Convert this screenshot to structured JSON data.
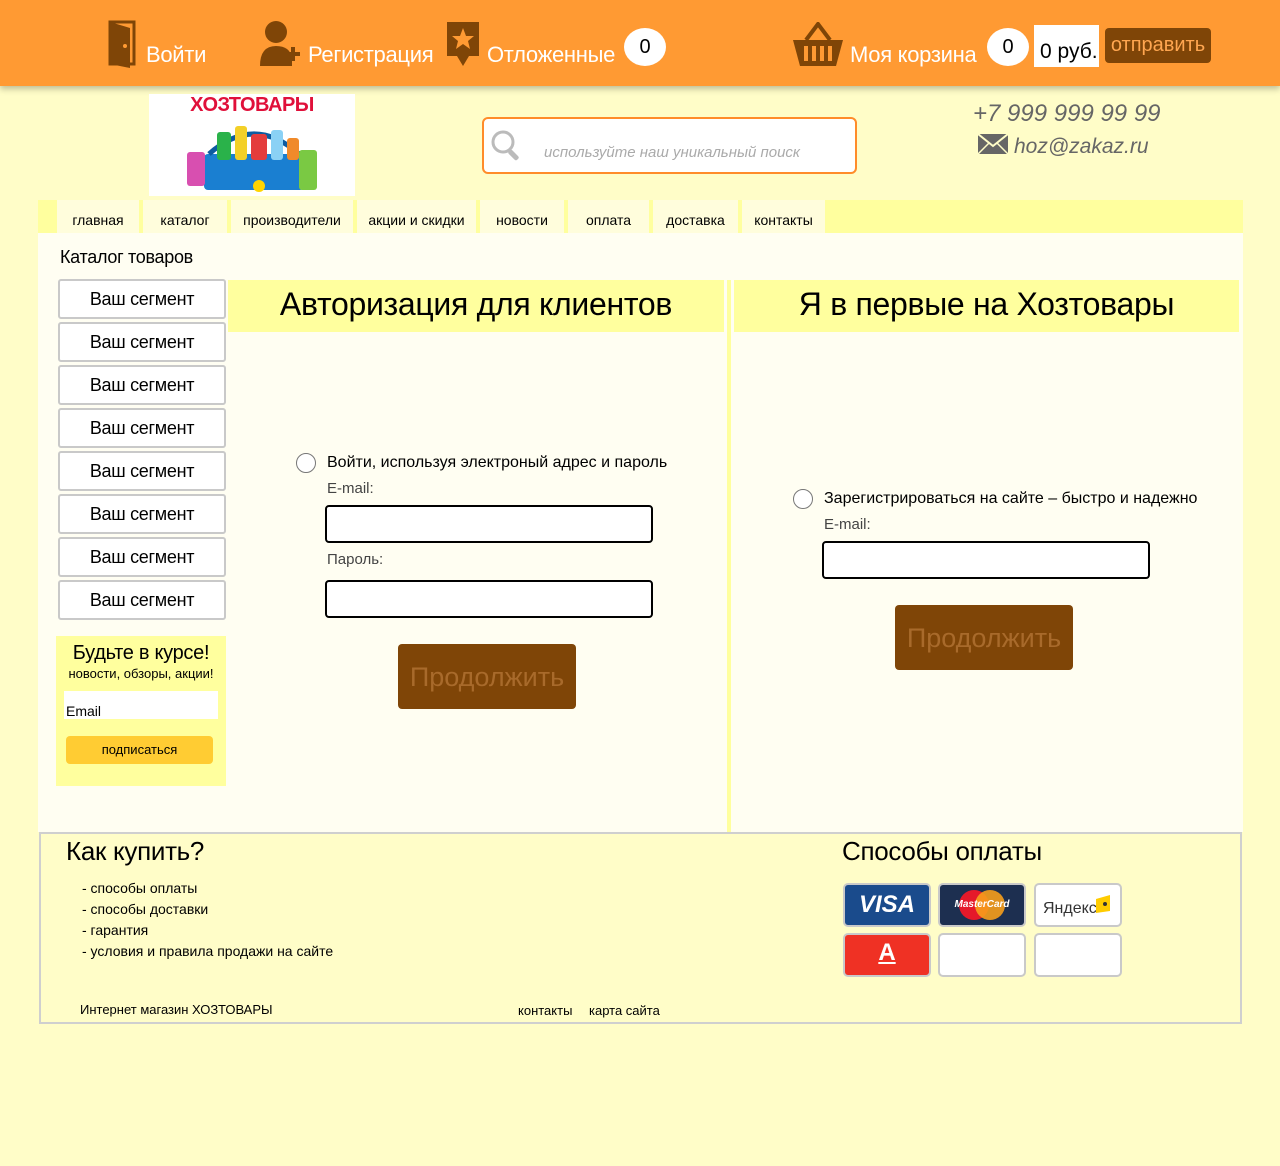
{
  "topbar": {
    "login": "Войти",
    "register": "Регистрация",
    "saved": "Отложенные",
    "saved_count": "0",
    "cart": "Моя корзина",
    "cart_count": "0",
    "cart_total": "0 руб.",
    "send": "отправить"
  },
  "header": {
    "logo_text": "ХОЗТОВАРЫ",
    "search_placeholder": "используйте наш уникальный поиск",
    "phone": "+7 999 999 99 99",
    "email": "hoz@zakaz.ru"
  },
  "nav": [
    "главная",
    "каталог",
    "производители",
    "акции и скидки",
    "новости",
    "оплата",
    "доставка",
    "контакты"
  ],
  "sidebar": {
    "title": "Каталог товаров",
    "segments": [
      "Ваш сегмент",
      "Ваш сегмент",
      "Ваш сегмент",
      "Ваш сегмент",
      "Ваш сегмент",
      "Ваш сегмент",
      "Ваш сегмент",
      "Ваш сегмент"
    ],
    "newsletter": {
      "title": "Будьте в курсе!",
      "subtitle": "новости, обзоры, акции!",
      "placeholder": "Email",
      "button": "подписаться"
    }
  },
  "login_panel": {
    "title": "Авторизация для клиентов",
    "radio_label": "Войти, используя электроный адрес и пароль",
    "email_label": "E-mail:",
    "password_label": "Пароль:",
    "button": "Продолжить"
  },
  "register_panel": {
    "title": "Я в первые на Хозтовары",
    "radio_label": "Зарегистрироваться на сайте – быстро и надежно",
    "email_label": "E-mail:",
    "button": "Продолжить"
  },
  "footer": {
    "how_to_buy": "Как купить?",
    "links": [
      "- способы оплаты",
      "- способы доставки",
      "- гарантия",
      "- условия и правила продажи на сайте"
    ],
    "payment_title": "Способы оплаты",
    "cards": [
      "VISA",
      "MasterCard",
      "Яндекс",
      "А"
    ],
    "shop_name": "Интернет магазин ХОЗТОВАРЫ",
    "contacts": "контакты",
    "sitemap": "карта сайта"
  },
  "colors": {
    "topbar": "#ff9a33",
    "background": "#fffdc8",
    "accent_brown": "#7f4507",
    "nav_yellow": "#ffff9e"
  }
}
